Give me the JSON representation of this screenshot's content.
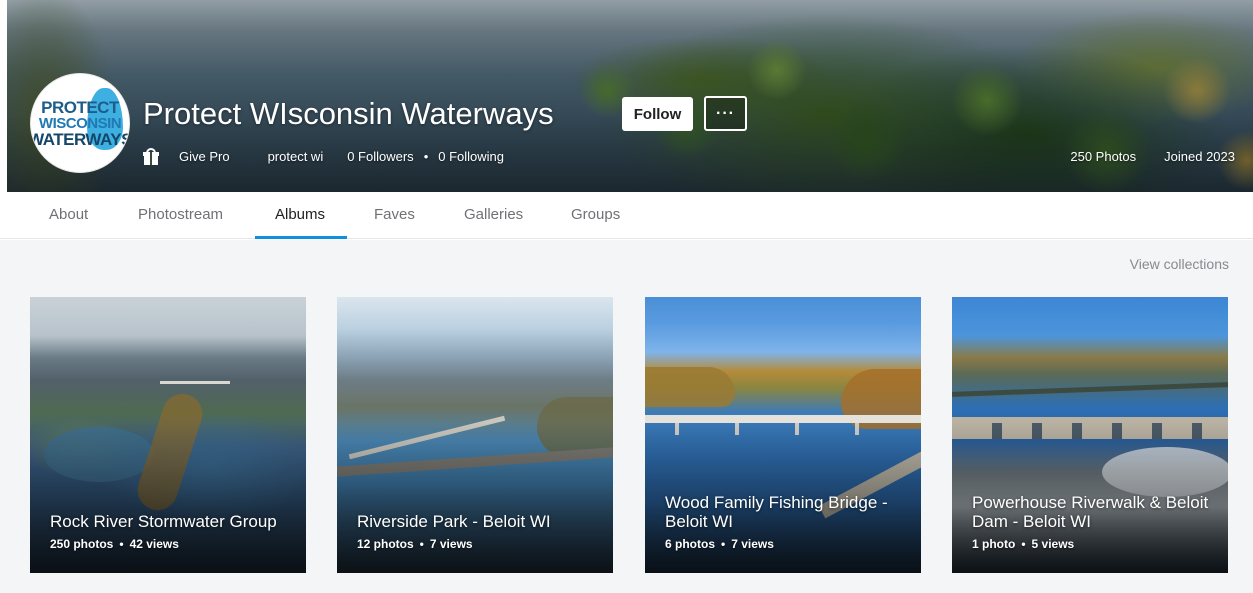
{
  "profile": {
    "avatar_text": [
      "PROTECT",
      "WISCONSIN",
      "WATERWAYS"
    ],
    "name": "Protect WIsconsin Waterways",
    "follow_label": "Follow",
    "more_label": "···",
    "pro_label": "Give Pro",
    "handle": "protect wi",
    "followers": "0 Followers",
    "following": "0 Following",
    "photo_count": "250 Photos",
    "joined": "Joined 2023"
  },
  "tabs": [
    {
      "label": "About"
    },
    {
      "label": "Photostream"
    },
    {
      "label": "Albums",
      "active": true
    },
    {
      "label": "Faves"
    },
    {
      "label": "Galleries"
    },
    {
      "label": "Groups"
    }
  ],
  "content": {
    "view_collections": "View collections"
  },
  "albums": [
    {
      "title": "Rock River Stormwater Group",
      "photos": "250 photos",
      "views": "42 views"
    },
    {
      "title": "Riverside Park - Beloit WI",
      "photos": "12 photos",
      "views": "7 views"
    },
    {
      "title": "Wood Family Fishing Bridge - Beloit WI",
      "photos": "6 photos",
      "views": "7 views"
    },
    {
      "title": "Powerhouse Riverwalk & Beloit Dam - Beloit WI",
      "photos": "1 photo",
      "views": "5 views"
    }
  ],
  "colors": {
    "accent": "#128fdc",
    "content_bg": "#f3f5f6",
    "tab_inactive": "#717176",
    "tab_active": "#212124"
  }
}
